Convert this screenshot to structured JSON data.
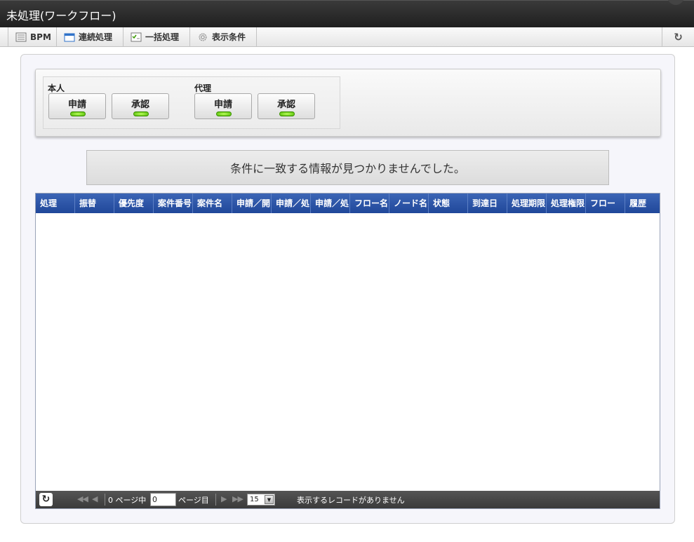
{
  "window": {
    "title": "未処理(ワークフロー)"
  },
  "toolbar": {
    "tabs": [
      {
        "label": "BPM",
        "icon": "list-icon"
      },
      {
        "label": "連続処理",
        "icon": "window-icon"
      },
      {
        "label": "一括処理",
        "icon": "checklist-icon"
      },
      {
        "label": "表示条件",
        "icon": "gear-icon"
      }
    ],
    "refresh_icon": "refresh-icon"
  },
  "filters": {
    "groups": [
      {
        "label": "本人",
        "buttons": [
          {
            "label": "申請"
          },
          {
            "label": "承認"
          }
        ]
      },
      {
        "label": "代理",
        "buttons": [
          {
            "label": "申請"
          },
          {
            "label": "承認"
          }
        ]
      }
    ],
    "led_color": "#7ad400"
  },
  "message": "条件に一致する情報が見つかりませんでした。",
  "grid": {
    "header_color": "#2a52a6",
    "columns": [
      "処理",
      "振替",
      "優先度",
      "案件番号",
      "案件名",
      "申請／開",
      "申請／処",
      "申請／処",
      "フロー名",
      "ノード名",
      "状態",
      "到達日",
      "処理期限",
      "処理権限",
      "フロー",
      "履歴"
    ],
    "rows": []
  },
  "pager": {
    "page_count_label": "0 ページ中",
    "page_value": "0",
    "page_suffix": "ページ目",
    "page_size": "15",
    "status": "表示するレコードがありません"
  }
}
